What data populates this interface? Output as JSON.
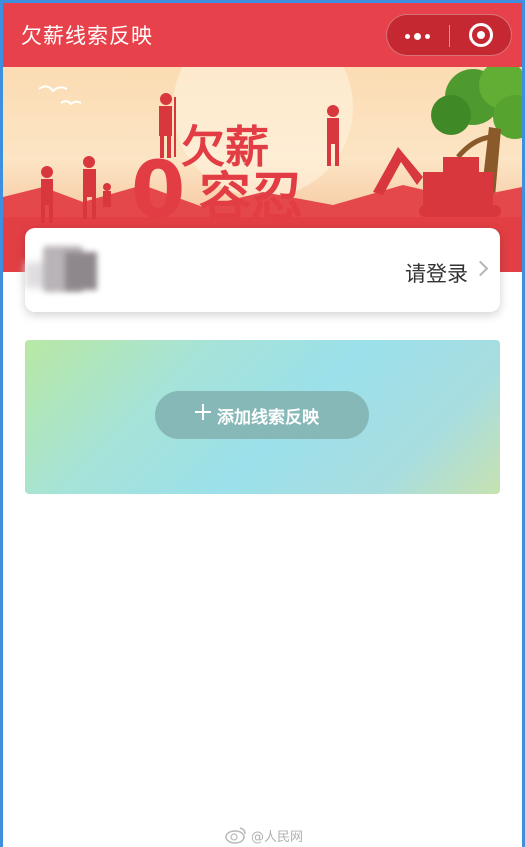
{
  "navbar": {
    "title": "欠薪线索反映",
    "more_icon": "more-dots-icon",
    "close_icon": "mini-program-close-icon",
    "background": "#e7424b"
  },
  "banner": {
    "headline_top": "欠薪",
    "headline_prefix": "0",
    "headline_bottom": "容忍"
  },
  "login": {
    "label": "请登录",
    "chevron_icon": "chevron-right-icon"
  },
  "add_panel": {
    "button_label": "添加线索反映",
    "plus_icon": "plus-icon"
  },
  "watermark": {
    "text": "@人民网",
    "icon": "weibo-icon"
  }
}
